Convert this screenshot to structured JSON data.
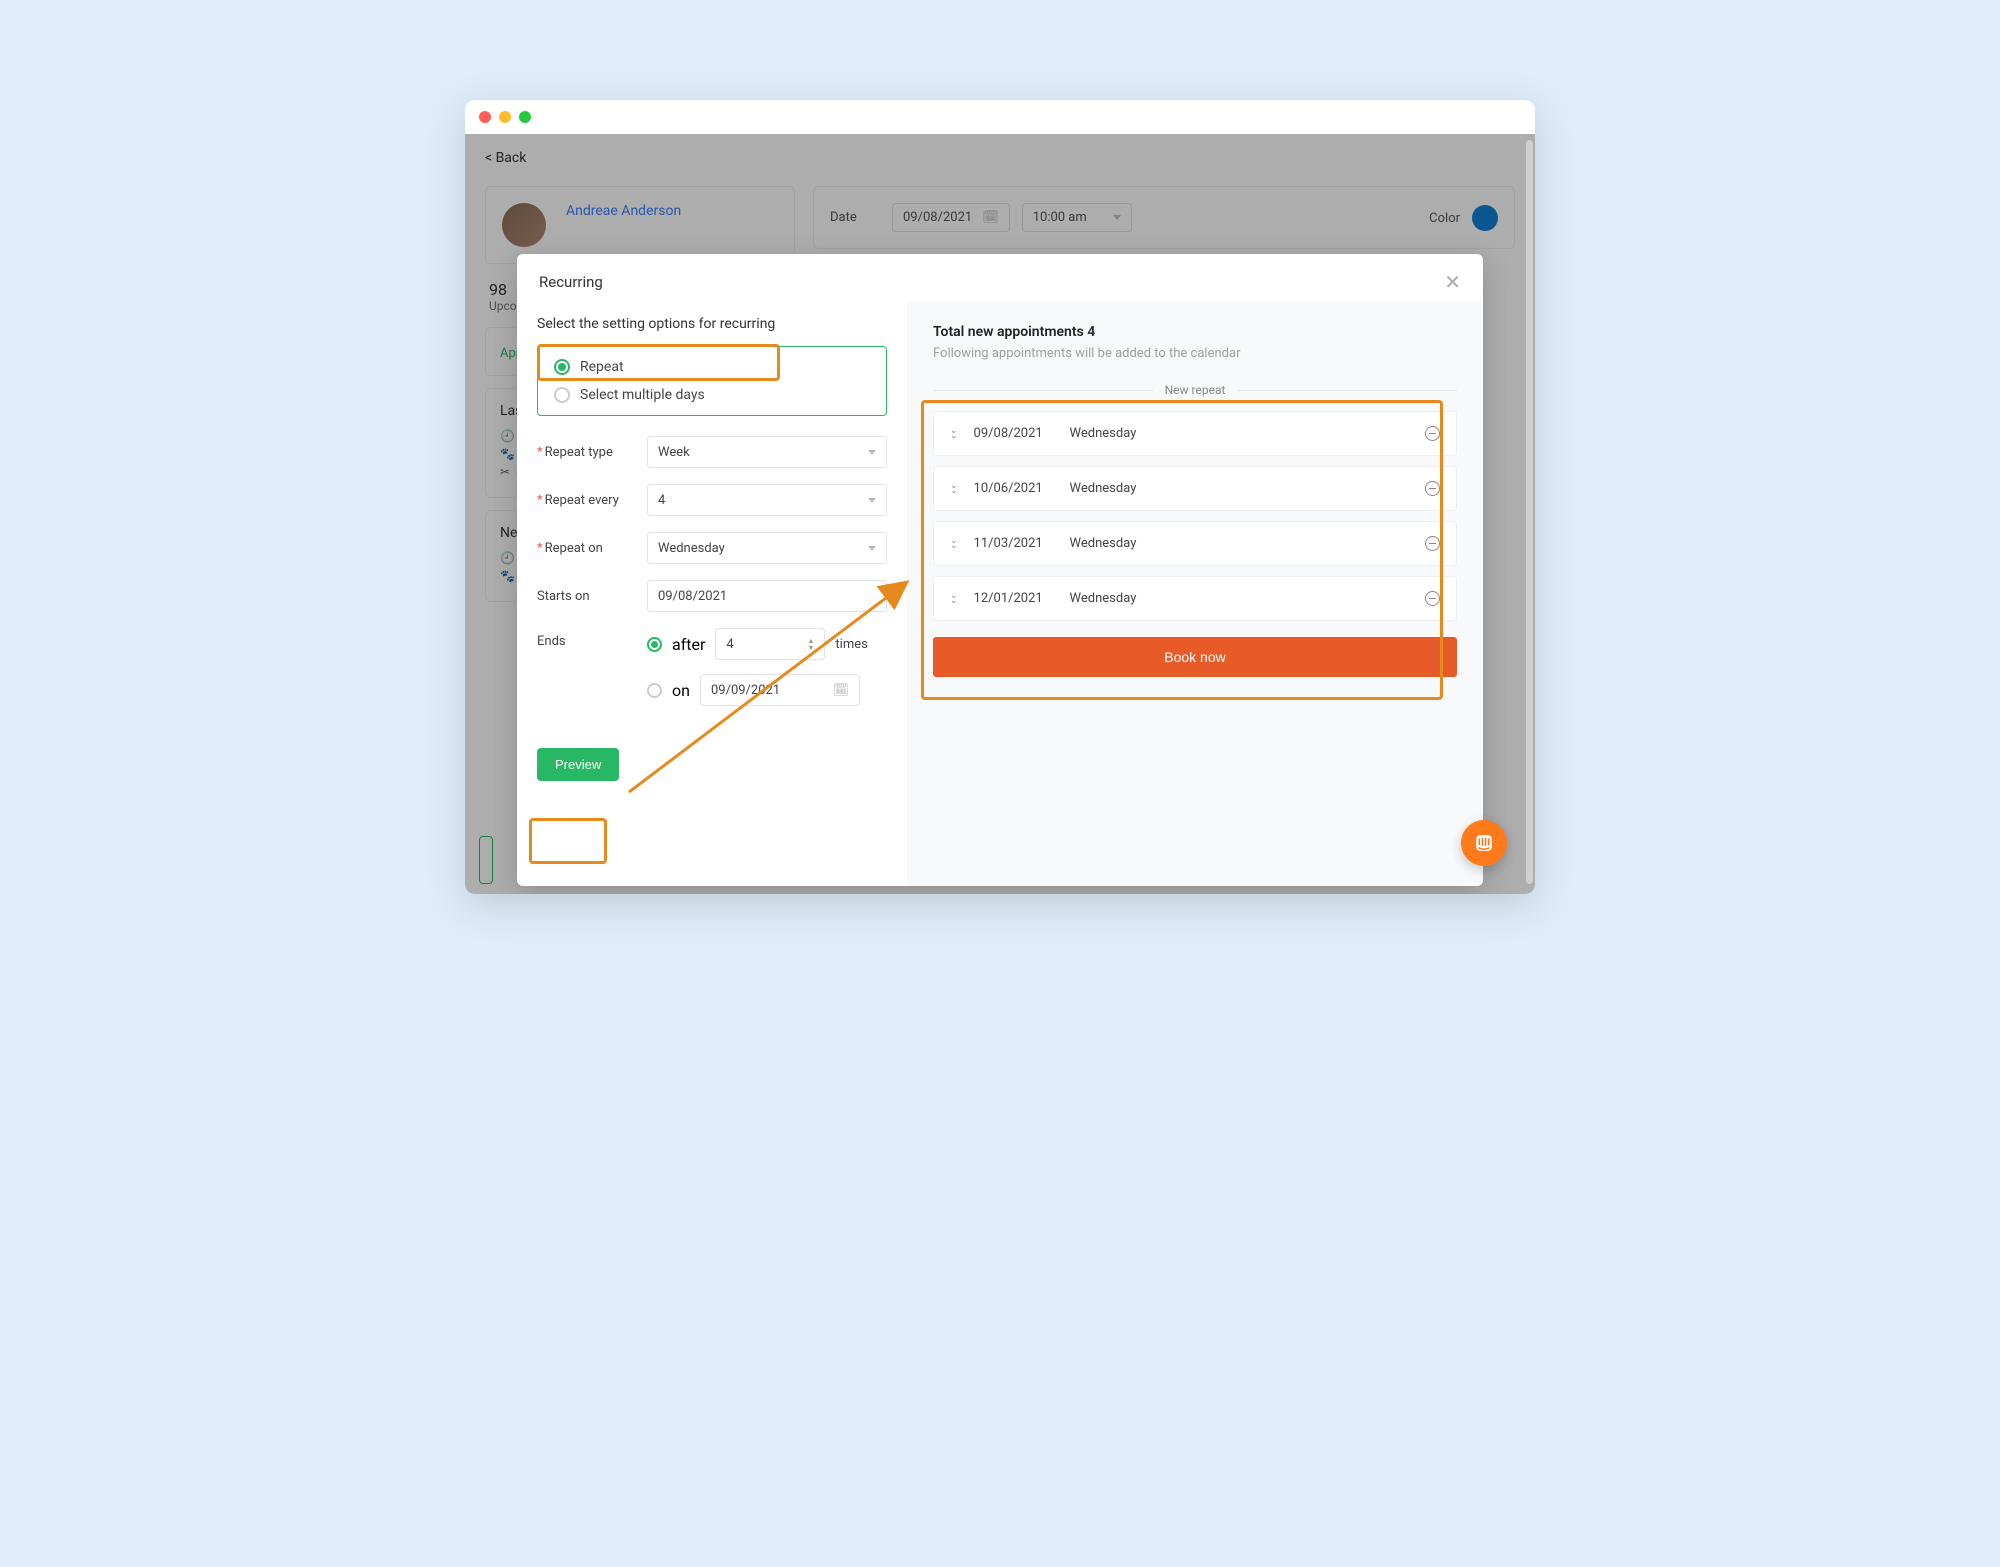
{
  "bg": {
    "back": "< Back",
    "name": "Andreae Anderson",
    "stat_num": "98",
    "stat_label": "Upcom",
    "date_label": "Date",
    "date_value": "09/08/2021",
    "time_value": "10:00 am",
    "color_label": "Color",
    "tab": "Appo",
    "last": "Last a",
    "next": "Next a",
    "meta_da": "Da",
    "meta_pe": "Pe",
    "meta_se": "Se"
  },
  "modal": {
    "title": "Recurring",
    "instruction": "Select the setting options for recurring",
    "options": {
      "repeat": "Repeat",
      "multiple": "Select multiple days"
    },
    "fields": {
      "repeat_type_label": "Repeat type",
      "repeat_type_value": "Week",
      "repeat_every_label": "Repeat every",
      "repeat_every_value": "4",
      "repeat_on_label": "Repeat on",
      "repeat_on_value": "Wednesday",
      "starts_on_label": "Starts on",
      "starts_on_value": "09/08/2021",
      "ends_label": "Ends",
      "ends_after": "after",
      "ends_times_value": "4",
      "ends_times_label": "times",
      "ends_on": "on",
      "ends_on_value": "09/09/2021"
    },
    "preview": "Preview"
  },
  "right": {
    "total_prefix": "Total new appointments ",
    "total_count": "4",
    "sub": "Following appointments will be added to the calendar",
    "divider": "New repeat",
    "book": "Book now",
    "appts": [
      {
        "date": "09/08/2021",
        "day": "Wednesday"
      },
      {
        "date": "10/06/2021",
        "day": "Wednesday"
      },
      {
        "date": "11/03/2021",
        "day": "Wednesday"
      },
      {
        "date": "12/01/2021",
        "day": "Wednesday"
      }
    ]
  }
}
